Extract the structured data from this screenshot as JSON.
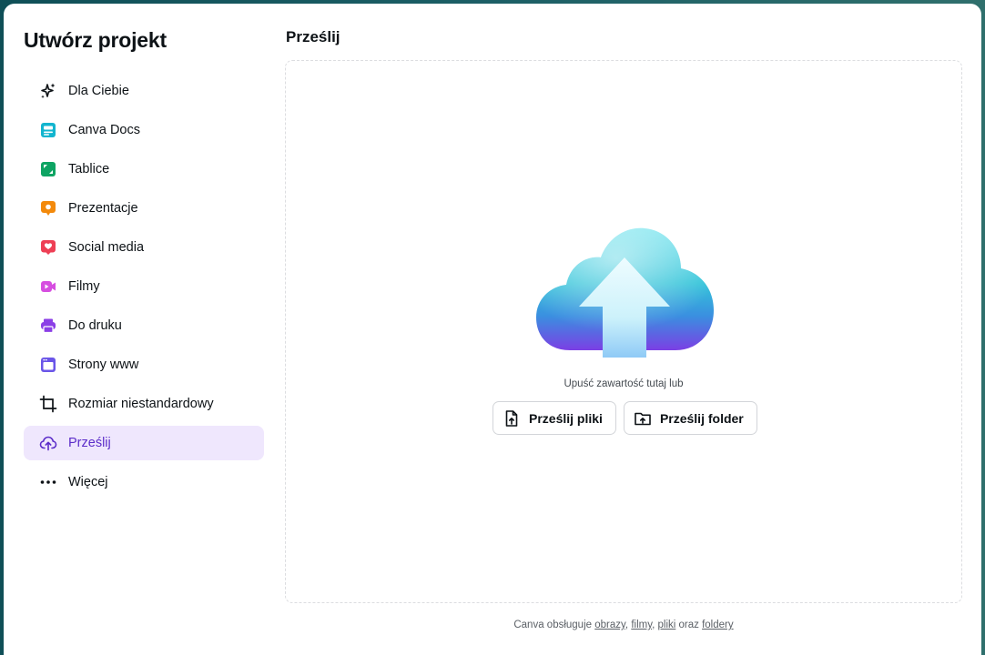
{
  "modal": {
    "title": "Utwórz projekt"
  },
  "sidebar": {
    "items": [
      {
        "label": "Dla Ciebie",
        "icon": "sparkle-icon",
        "color": "#0d1216"
      },
      {
        "label": "Canva Docs",
        "icon": "docs-icon",
        "color": "#13b5cf"
      },
      {
        "label": "Tablice",
        "icon": "whiteboard-icon",
        "color": "#0ea463"
      },
      {
        "label": "Prezentacje",
        "icon": "presentation-icon",
        "color": "#f38a0c"
      },
      {
        "label": "Social media",
        "icon": "heart-icon",
        "color": "#ee3f55"
      },
      {
        "label": "Filmy",
        "icon": "video-icon",
        "color": "#d64ee0"
      },
      {
        "label": "Do druku",
        "icon": "print-icon",
        "color": "#8b3fe6"
      },
      {
        "label": "Strony www",
        "icon": "website-icon",
        "color": "#6a55e8"
      },
      {
        "label": "Rozmiar niestandardowy",
        "icon": "custom-size-icon",
        "color": "#0d1216"
      },
      {
        "label": "Prześlij",
        "icon": "cloud-upload-icon",
        "color": "#5b2cc9",
        "active": true
      },
      {
        "label": "Więcej",
        "icon": "more-icon",
        "color": "#0d1216"
      }
    ]
  },
  "main": {
    "title": "Prześlij",
    "drop_text": "Upuść zawartość tutaj lub",
    "upload_files_label": "Prześlij pliki",
    "upload_folder_label": "Prześlij folder",
    "footer": {
      "prefix": "Canva obsługuje",
      "link_images": "obrazy",
      "sep1": ",",
      "link_videos": "filmy",
      "sep2": ",",
      "link_files": "pliki",
      "conj": "oraz",
      "link_folders": "foldery"
    }
  },
  "colors": {
    "accent": "#5b2cc9",
    "active_bg": "#efe7fd"
  }
}
